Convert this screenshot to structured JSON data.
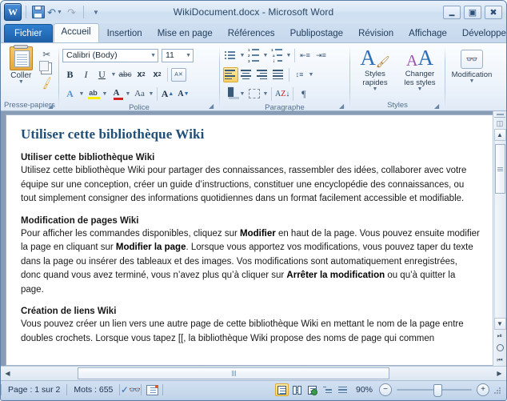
{
  "titlebar": {
    "app_icon": "word-logo",
    "logo_letter": "W",
    "document_title": "WikiDocument.docx  -  Microsoft Word",
    "quick_access": [
      {
        "name": "save",
        "icon": "save-icon"
      },
      {
        "name": "undo",
        "icon": "undo-arrow-icon"
      },
      {
        "name": "redo",
        "icon": "redo-arrow-icon"
      },
      {
        "name": "customize",
        "icon": "chevron-down-icon"
      }
    ],
    "window_buttons": [
      {
        "name": "minimize",
        "glyph": "—"
      },
      {
        "name": "maximize",
        "glyph": "□"
      },
      {
        "name": "close",
        "glyph": "✕"
      }
    ]
  },
  "tabs": {
    "file_label": "Fichier",
    "items": [
      {
        "label": "Accueil",
        "active": true
      },
      {
        "label": "Insertion",
        "active": false
      },
      {
        "label": "Mise en page",
        "active": false
      },
      {
        "label": "Références",
        "active": false
      },
      {
        "label": "Publipostage",
        "active": false
      },
      {
        "label": "Révision",
        "active": false
      },
      {
        "label": "Affichage",
        "active": false
      },
      {
        "label": "Développeur",
        "active": false
      }
    ],
    "collapse_icon": "chevron-up-icon",
    "help_label": "?"
  },
  "ribbon": {
    "clipboard": {
      "group_label": "Presse-papiers",
      "paste_label": "Coller",
      "cut_label": "Couper",
      "copy_label": "Copier",
      "format_painter_label": "Reproduire la mise en forme"
    },
    "font": {
      "group_label": "Police",
      "font_name": "Calibri (Body)",
      "font_size": "11",
      "bold": "B",
      "italic": "I",
      "underline": "U",
      "strikethrough": "abc",
      "subscript": "x",
      "superscript": "x",
      "clear_format": "A",
      "text_effects": "A",
      "highlight": "ab",
      "font_color": "A",
      "change_case": "Aa",
      "grow_font": "A",
      "shrink_font": "A"
    },
    "paragraph": {
      "group_label": "Paragraphe",
      "bullets": "bullet-list",
      "numbering": "numbered-list",
      "multilevel": "multilevel-list",
      "decrease_indent": "decrease-indent",
      "increase_indent": "increase-indent",
      "line_spacing": "line-spacing",
      "align_left": "align-left",
      "align_center": "align-center",
      "align_right": "align-right",
      "justify": "justify",
      "shading": "shading",
      "borders": "borders",
      "sort": "sort",
      "show_marks": "¶"
    },
    "styles": {
      "group_label": "Styles",
      "quick_styles_line1": "Styles",
      "quick_styles_line2": "rapides",
      "change_styles_line1": "Changer",
      "change_styles_line2": "les styles"
    },
    "editing": {
      "group_label": "",
      "label": "Modification",
      "icon": "binoculars-icon"
    }
  },
  "document": {
    "title": "Utiliser cette bibliothèque Wiki",
    "sections": [
      {
        "heading": "Utiliser cette bibliothèque Wiki",
        "paragraph_html": "Utilisez cette bibliothèque Wiki pour partager des connaissances, rassembler des idées, collaborer avec votre équipe sur une conception, créer un guide d’instructions, constituer une encyclopédie des connaissances, ou tout simplement consigner des informations quotidiennes dans un format facilement accessible et modifiable."
      },
      {
        "heading": "Modification de pages Wiki",
        "paragraph_html": "Pour afficher les commandes disponibles, cliquez sur <b>Modifier</b> en haut de la page. Vous pouvez ensuite modifier la page en cliquant sur <b>Modifier la page</b>. Lorsque vous apportez vos modifications, vous pouvez taper du texte dans la page ou insérer des tableaux et des images. Vos modifications sont automatiquement enregistrées, donc quand vous avez terminé, vous n’avez plus qu’à cliquer sur <b>Arrêter la modification</b> ou qu’à quitter la page."
      },
      {
        "heading": "Création de liens Wiki",
        "paragraph_html": "Vous pouvez créer un lien vers une autre page de cette bibliothèque Wiki en mettant le nom de la page entre doubles crochets. Lorsque vous tapez [[, la bibliothèque Wiki propose des noms de page qui commen"
      }
    ]
  },
  "scrollbars": {
    "vertical": {
      "split_bar": "split-bar",
      "ruler_toggle": "ruler-toggle-icon",
      "up_arrow": "▲",
      "down_arrow": "▼",
      "previous_page": "⬆",
      "browse_object": "browse-object-icon",
      "next_page": "⬇"
    },
    "horizontal": {
      "left_arrow": "◀",
      "right_arrow": "▶"
    }
  },
  "status": {
    "page_label": "Page : 1 sur 2",
    "words_label": "Mots : 655",
    "proofing_icon": "proofing-errors-icon",
    "language_icon": "language-icon",
    "views": [
      {
        "name": "print-layout",
        "active": true
      },
      {
        "name": "full-screen-reading",
        "active": false
      },
      {
        "name": "web-layout",
        "active": false
      },
      {
        "name": "outline",
        "active": false
      },
      {
        "name": "draft",
        "active": false
      }
    ],
    "zoom_level": "90%",
    "zoom_out_label": "−",
    "zoom_in_label": "+"
  },
  "colors": {
    "accent": "#1f4e79",
    "file_tab": "#1d5fa6",
    "highlight_yellow": "#ffd064",
    "window_chrome": "#c3d5ec"
  }
}
